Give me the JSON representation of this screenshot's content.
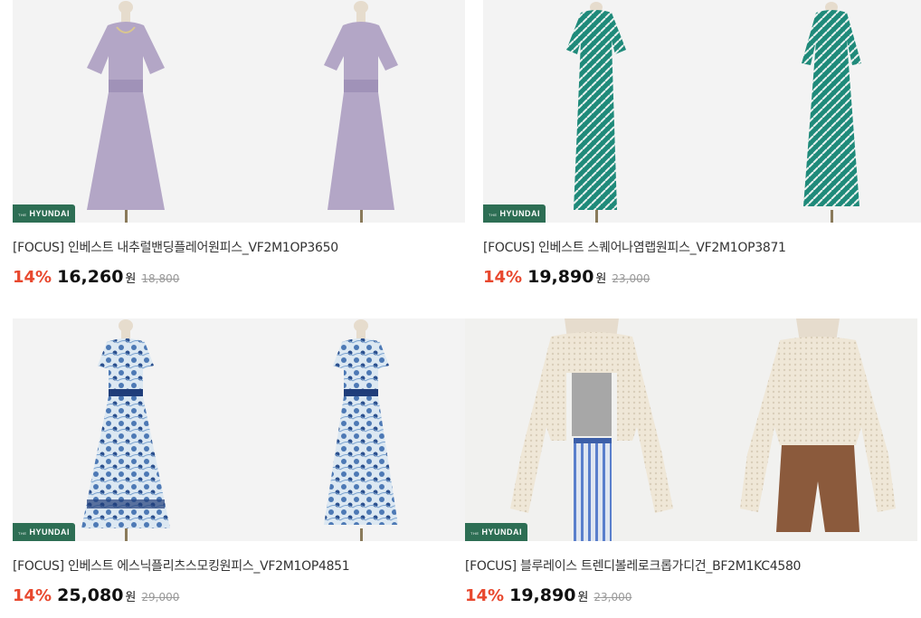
{
  "products": [
    {
      "badge": {
        "the": "THE",
        "brand": "HYUNDAI"
      },
      "title": "[FOCUS] 인베스트 내추럴밴딩플레어원피스_VF2M1OP3650",
      "discount": "14%",
      "price": "16,260",
      "currency": "원",
      "original_price": "18,800",
      "colors": {
        "garment": "#b3a6c6",
        "accent": "#9c8eb3"
      }
    },
    {
      "badge": {
        "the": "THE",
        "brand": "HYUNDAI"
      },
      "title": "[FOCUS] 인베스트 스퀘어나염랩원피스_VF2M1OP3871",
      "discount": "14%",
      "price": "19,890",
      "currency": "원",
      "original_price": "23,000",
      "colors": {
        "garment": "#1f8a7a",
        "accent": "#e9f1ee"
      }
    },
    {
      "badge": {
        "the": "THE",
        "brand": "HYUNDAI"
      },
      "title": "[FOCUS] 인베스트 에스닉플리츠스모킹원피스_VF2M1OP4851",
      "discount": "14%",
      "price": "25,080",
      "currency": "원",
      "original_price": "29,000",
      "colors": {
        "garment": "#4d79b5",
        "accent": "#dce8f2"
      }
    },
    {
      "badge": {
        "the": "THE",
        "brand": "HYUNDAI"
      },
      "title": "[FOCUS] 블루레이스 트렌디볼레로크롭가디건_BF2M1KC4580",
      "discount": "14%",
      "price": "19,890",
      "currency": "원",
      "original_price": "23,000",
      "colors": {
        "garment": "#efe6d6",
        "accent": "#8b5a3c"
      }
    }
  ]
}
